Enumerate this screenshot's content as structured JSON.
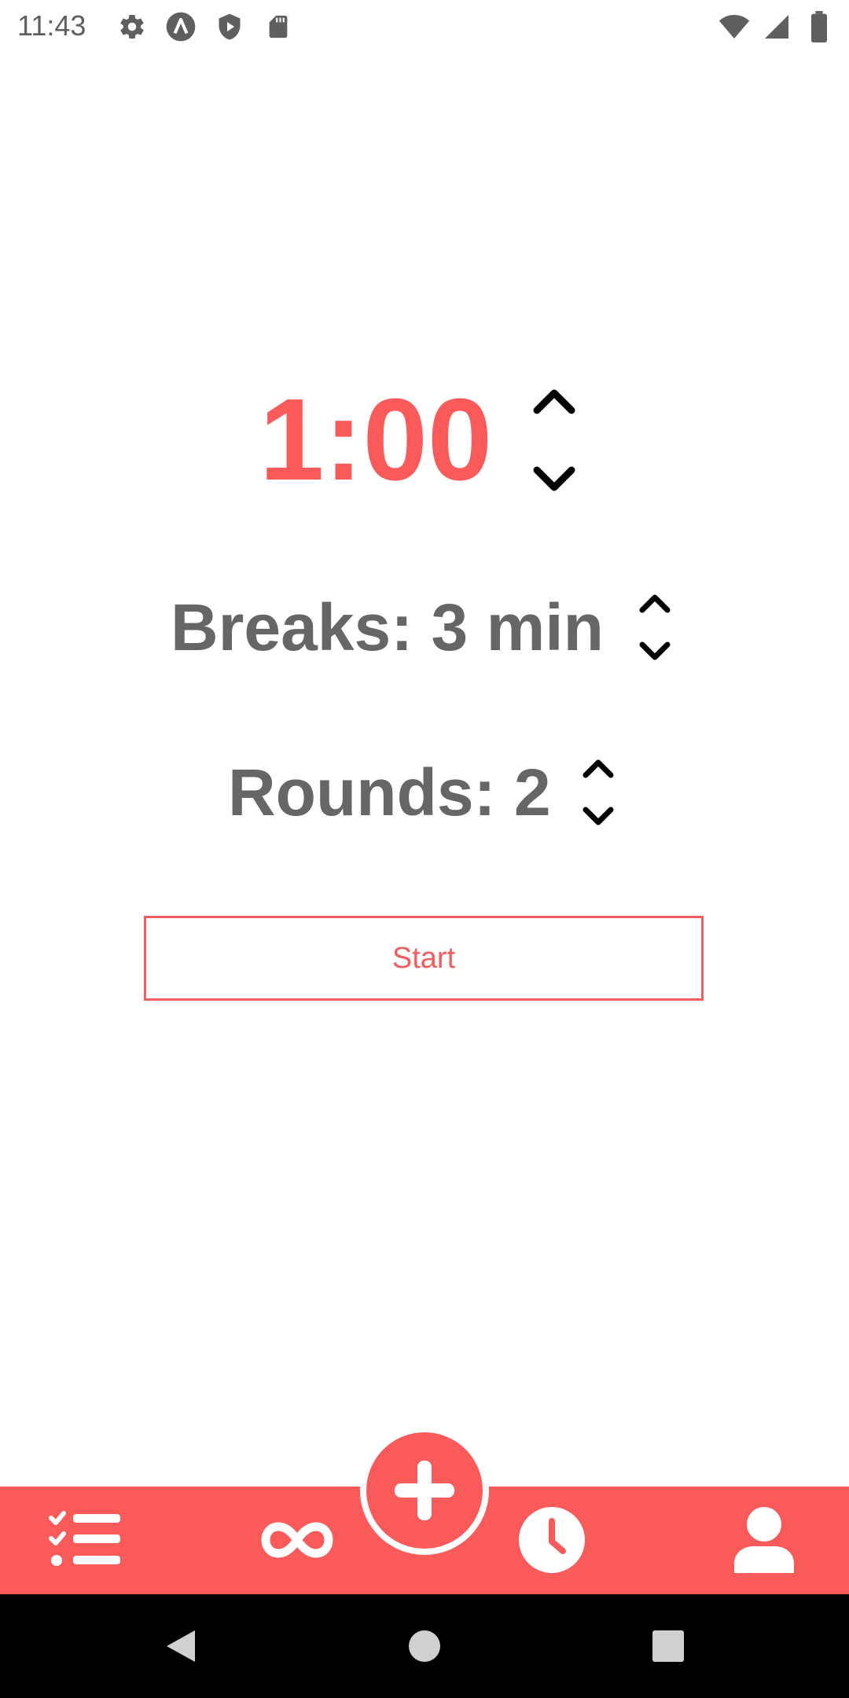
{
  "status_bar": {
    "time": "11:43",
    "left_icons": [
      "gear-icon",
      "app-a-icon",
      "shield-play-icon",
      "sd-card-icon"
    ],
    "right_icons": [
      "wifi-icon",
      "signal-icon",
      "battery-icon"
    ]
  },
  "timer": {
    "value": "1:00",
    "color": "#fa5a5a"
  },
  "breaks": {
    "text": "Breaks: 3 min"
  },
  "rounds": {
    "text": "Rounds: 2"
  },
  "start_button": {
    "label": "Start",
    "color": "#f35d5d"
  },
  "bottom_nav": {
    "background": "#fa5a5a",
    "items": [
      "checklist-icon",
      "infinity-icon",
      "add-icon",
      "clock-icon",
      "user-icon"
    ]
  },
  "system_nav": {
    "items": [
      "back-icon",
      "home-icon",
      "recents-icon"
    ]
  }
}
